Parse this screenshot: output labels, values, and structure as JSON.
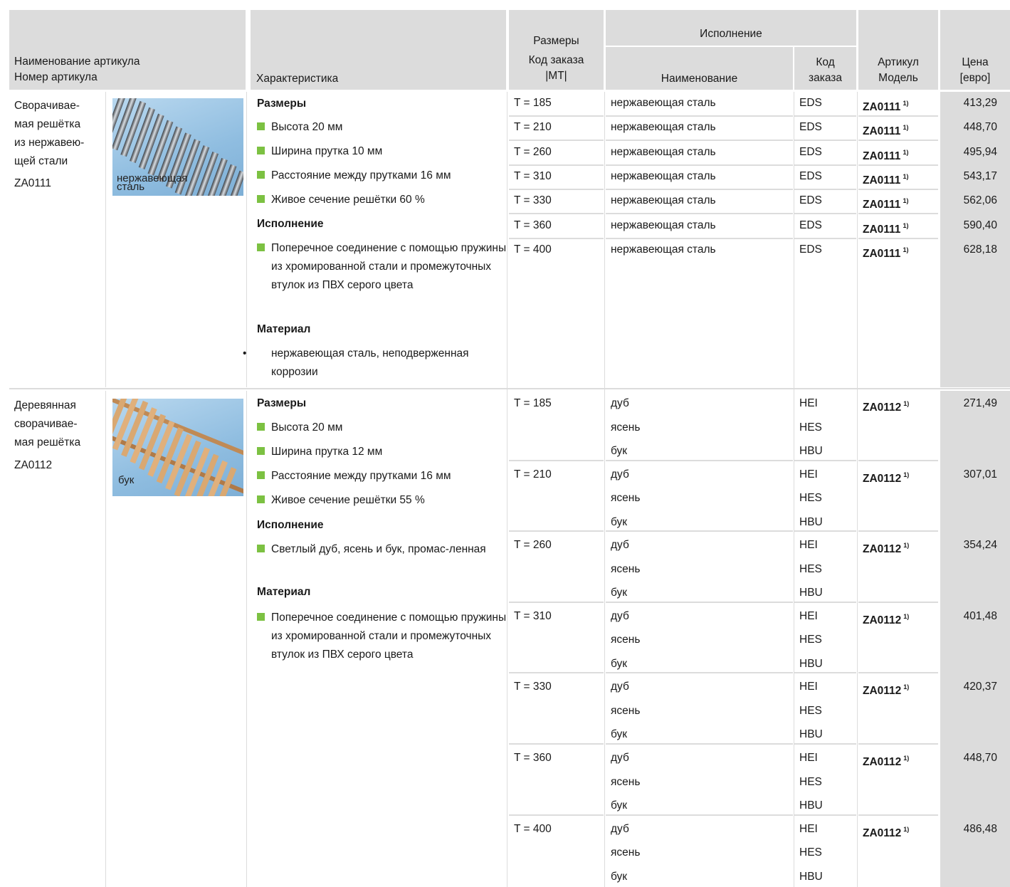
{
  "header": {
    "col_name_line1": "Наименование артикула",
    "col_name_line2": "Номер артикула",
    "col_char": "Характеристика",
    "col_size_line1": "Размеры",
    "col_size_line2": "Код заказа",
    "col_size_line3": "|MT|",
    "col_exec": "Исполнение",
    "col_exec_name": "Наименование",
    "col_exec_code_line1": "Код",
    "col_exec_code_line2": "заказа",
    "col_article_line1": "Артикул",
    "col_article_line2": "Модель",
    "col_price_line1": "Цена",
    "col_price_line2": "[евро]"
  },
  "products": [
    {
      "name_lines": [
        "Сворачивае-",
        "мая решётка",
        "из нержавею-",
        "щей стали",
        "ZA0111"
      ],
      "photo_label_lines": [
        "нержавеющая",
        "сталь"
      ],
      "photo_icon": "stainless-grating-photo",
      "sections": [
        {
          "title": "Размеры",
          "items": [
            "Высота 20 мм",
            "Ширина прутка 10 мм",
            "Расстояние между прутками 16 мм",
            "Живое сечение решётки 60 %"
          ]
        },
        {
          "title": "Исполнение",
          "items": [
            "Поперечное соединение с помощью пружины из хромированной стали и промежуточных втулок из ПВХ серого цвета"
          ]
        },
        {
          "title": "Материал",
          "items": [
            "нержавеющая сталь, неподверженная коррозии"
          ]
        }
      ],
      "rows": [
        {
          "size": "T = 185",
          "exec": "нержавеющая сталь",
          "code": "EDS",
          "article": "ZA0111",
          "footnote": "1)",
          "price": "413,29"
        },
        {
          "size": "T = 210",
          "exec": "нержавеющая сталь",
          "code": "EDS",
          "article": "ZA0111",
          "footnote": "1)",
          "price": "448,70"
        },
        {
          "size": "T = 260",
          "exec": "нержавеющая сталь",
          "code": "EDS",
          "article": "ZA0111",
          "footnote": "1)",
          "price": "495,94"
        },
        {
          "size": "T = 310",
          "exec": "нержавеющая сталь",
          "code": "EDS",
          "article": "ZA0111",
          "footnote": "1)",
          "price": "543,17"
        },
        {
          "size": "T = 330",
          "exec": "нержавеющая сталь",
          "code": "EDS",
          "article": "ZA0111",
          "footnote": "1)",
          "price": "562,06"
        },
        {
          "size": "T = 360",
          "exec": "нержавеющая сталь",
          "code": "EDS",
          "article": "ZA0111",
          "footnote": "1)",
          "price": "590,40"
        },
        {
          "size": "T = 400",
          "exec": "нержавеющая сталь",
          "code": "EDS",
          "article": "ZA0111",
          "footnote": "1)",
          "price": "628,18"
        }
      ]
    },
    {
      "name_lines": [
        "Деревянная",
        "сворачивае-",
        "мая решётка",
        "ZA0112"
      ],
      "photo_label_lines": [
        "бук"
      ],
      "photo_icon": "wooden-grating-photo",
      "sections": [
        {
          "title": "Размеры",
          "items": [
            "Высота 20 мм",
            "Ширина прутка 12 мм",
            "Расстояние между прутками 16 мм",
            "Живое сечение решётки 55 %"
          ]
        },
        {
          "title": "Исполнение",
          "items": [
            "Светлый дуб, ясень и бук, промас-ленная"
          ]
        },
        {
          "title": "Материал",
          "items": [
            "Поперечное соединение с помощью пружины из хромированной стали и промежуточных втулок из ПВХ серого цвета"
          ]
        }
      ],
      "variants": [
        {
          "name": "дуб",
          "code": "HEI"
        },
        {
          "name": "ясень",
          "code": "HES"
        },
        {
          "name": "бук",
          "code": "HBU"
        }
      ],
      "rows": [
        {
          "size": "T = 185",
          "article": "ZA0112",
          "footnote": "1)",
          "price": "271,49"
        },
        {
          "size": "T = 210",
          "article": "ZA0112",
          "footnote": "1)",
          "price": "307,01"
        },
        {
          "size": "T = 260",
          "article": "ZA0112",
          "footnote": "1)",
          "price": "354,24"
        },
        {
          "size": "T = 310",
          "article": "ZA0112",
          "footnote": "1)",
          "price": "401,48"
        },
        {
          "size": "T = 330",
          "article": "ZA0112",
          "footnote": "1)",
          "price": "420,37"
        },
        {
          "size": "T = 360",
          "article": "ZA0112",
          "footnote": "1)",
          "price": "448,70"
        },
        {
          "size": "T = 400",
          "article": "ZA0112",
          "footnote": "1)",
          "price": "486,48"
        }
      ]
    }
  ],
  "colors": {
    "header_bg": "#dcdcdc",
    "bullet_green": "#7cc142",
    "divider": "#dcdcdc"
  }
}
